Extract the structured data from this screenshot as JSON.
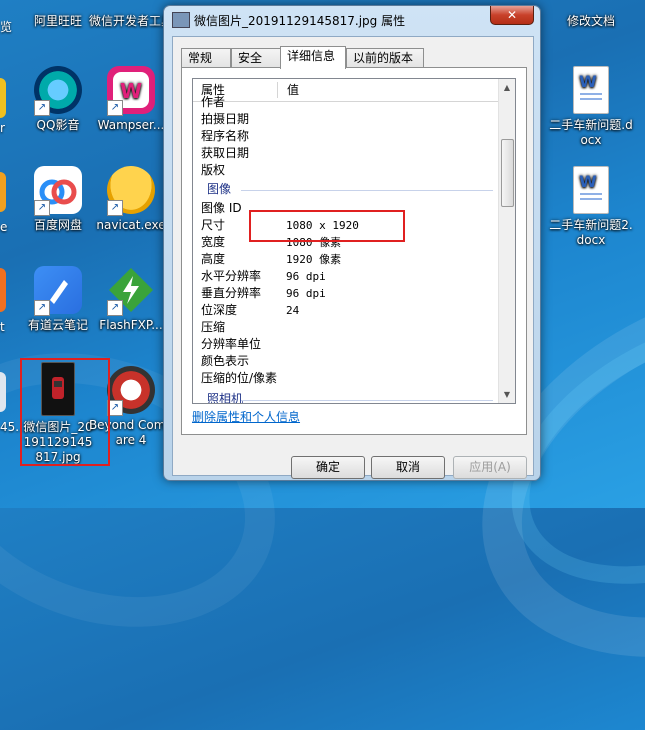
{
  "desktop": {
    "partial_left": {
      "top_label": "览",
      "mid_label": "r",
      "row3_label": "e",
      "row4_label": "t",
      "row5_label": "45..."
    },
    "icons": [
      {
        "label": "阿里旺旺",
        "icon": "aliwangwang-icon"
      },
      {
        "label": "微信开发者工具",
        "icon": "wechat-devtools-icon"
      },
      {
        "label": "QQ影音",
        "icon": "qqplayer-icon"
      },
      {
        "label": "Wampser...",
        "icon": "wampserver-icon"
      },
      {
        "label": "百度网盘",
        "icon": "baidu-netdisk-icon"
      },
      {
        "label": "navicat.exe",
        "icon": "navicat-icon"
      },
      {
        "label": "有道云笔记",
        "icon": "youdao-note-icon"
      },
      {
        "label": "FlashFXP...",
        "icon": "flashfxp-icon"
      },
      {
        "label": "微信图片_20191129145817.jpg",
        "icon": "image-file-icon"
      },
      {
        "label": "Beyond Compare 4",
        "icon": "beyond-compare-icon"
      },
      {
        "label": "修改文档",
        "icon": "folder-icon"
      },
      {
        "label": "二手车新问题.docx",
        "icon": "word-doc-icon"
      },
      {
        "label": "二手车新问题2.docx",
        "icon": "word-doc-icon"
      }
    ]
  },
  "window": {
    "title": "微信图片_20191129145817.jpg 属性",
    "close_label": "✕",
    "tabs": [
      "常规",
      "安全",
      "详细信息",
      "以前的版本"
    ],
    "active_tab": "详细信息",
    "list": {
      "header_property": "属性",
      "header_value": "值",
      "rows_before": [
        {
          "k": "作者",
          "v": ""
        },
        {
          "k": "拍摄日期",
          "v": ""
        },
        {
          "k": "程序名称",
          "v": ""
        },
        {
          "k": "获取日期",
          "v": ""
        },
        {
          "k": "版权",
          "v": ""
        }
      ],
      "group_image": "图像",
      "rows_image": [
        {
          "k": "图像 ID",
          "v": ""
        },
        {
          "k": "尺寸",
          "v": "1080 x 1920"
        },
        {
          "k": "宽度",
          "v": "1080 像素"
        },
        {
          "k": "高度",
          "v": "1920 像素"
        },
        {
          "k": "水平分辨率",
          "v": "96 dpi"
        },
        {
          "k": "垂直分辨率",
          "v": "96 dpi"
        },
        {
          "k": "位深度",
          "v": "24"
        },
        {
          "k": "压缩",
          "v": ""
        },
        {
          "k": "分辨率单位",
          "v": ""
        },
        {
          "k": "颜色表示",
          "v": ""
        },
        {
          "k": "压缩的位/像素",
          "v": ""
        }
      ],
      "group_camera": "照相机"
    },
    "delete_link": "删除属性和个人信息",
    "buttons": {
      "ok": "确定",
      "cancel": "取消",
      "apply": "应用(A)"
    }
  },
  "colors": {
    "highlight_box": "#e02020",
    "desktop_blue": "#1a6fb3"
  }
}
